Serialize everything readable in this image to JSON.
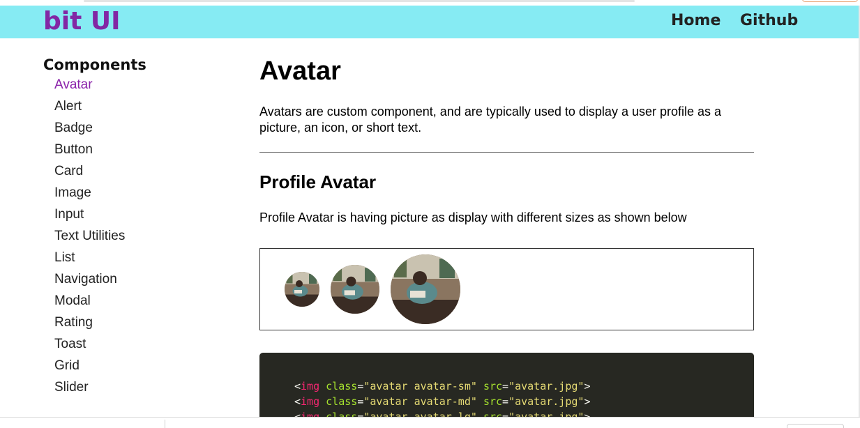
{
  "navbar": {
    "brand": "bit UI",
    "links": [
      {
        "label": "Home"
      },
      {
        "label": "Github"
      }
    ],
    "background": "#86ebf3",
    "brand_color": "#8227a4"
  },
  "sidebar": {
    "title": "Components",
    "active_index": 0,
    "items": [
      {
        "label": "Avatar"
      },
      {
        "label": "Alert"
      },
      {
        "label": "Badge"
      },
      {
        "label": "Button"
      },
      {
        "label": "Card"
      },
      {
        "label": "Image"
      },
      {
        "label": "Input"
      },
      {
        "label": "Text Utilities"
      },
      {
        "label": "List"
      },
      {
        "label": "Navigation"
      },
      {
        "label": "Modal"
      },
      {
        "label": "Rating"
      },
      {
        "label": "Toast"
      },
      {
        "label": "Grid"
      },
      {
        "label": "Slider"
      }
    ],
    "active_bg": "#a399a6",
    "active_color": "#8a22aa"
  },
  "main": {
    "title": "Avatar",
    "intro": "Avatars are custom component, and are typically used to display a user profile as a picture, an icon, or short text.",
    "section": {
      "title": "Profile Avatar",
      "description": "Profile Avatar is having picture as display with different sizes as shown below"
    },
    "demo_avatars": [
      {
        "size": "sm"
      },
      {
        "size": "md"
      },
      {
        "size": "lg"
      }
    ],
    "code": {
      "background": "#272822",
      "lines": [
        {
          "open": "<",
          "tag": "img",
          "attr1": "class",
          "eq1": "=",
          "val1": "\"avatar avatar-sm\"",
          "attr2": "src",
          "eq2": "=",
          "val2": "\"avatar.jpg\"",
          "close": ">"
        },
        {
          "open": "<",
          "tag": "img",
          "attr1": "class",
          "eq1": "=",
          "val1": "\"avatar avatar-md\"",
          "attr2": "src",
          "eq2": "=",
          "val2": "\"avatar.jpg\"",
          "close": ">"
        },
        {
          "open": "<",
          "tag": "img",
          "attr1": "class",
          "eq1": "=",
          "val1": "\"avatar avatar-lg\"",
          "attr2": "src",
          "eq2": "=",
          "val2": "\"avatar.jpg\"",
          "close": ">"
        }
      ]
    }
  }
}
